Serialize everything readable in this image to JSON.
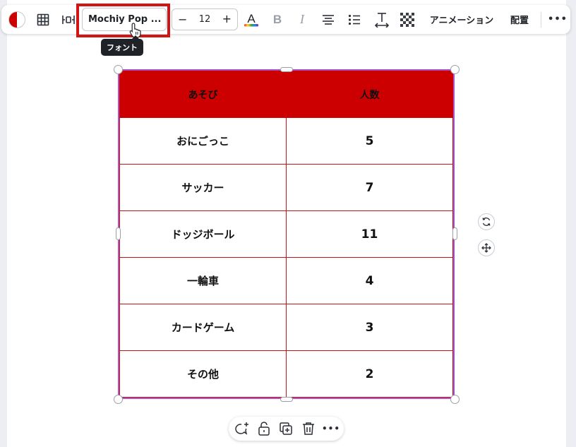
{
  "toolbar": {
    "font_name": "Mochiy Pop ...",
    "font_size": "12",
    "size_minus": "−",
    "size_plus": "+",
    "animation_label": "アニメーション",
    "arrange_label": "配置",
    "more_label": "•••",
    "text_color": "#cc0000"
  },
  "tooltip": {
    "text": "フォント"
  },
  "table": {
    "headers": [
      "あそび",
      "人数"
    ],
    "rows": [
      [
        "おにごっこ",
        "5"
      ],
      [
        "サッカー",
        "7"
      ],
      [
        "ドッジボール",
        "11"
      ],
      [
        "一輪車",
        "4"
      ],
      [
        "カードゲーム",
        "3"
      ],
      [
        "その他",
        "2"
      ]
    ],
    "header_color": "#cc0000",
    "border_color": "#c41414",
    "selection_color": "#a855c9"
  },
  "bottom_bar": {
    "more_label": "•••"
  },
  "icons": [
    "color-swatch-icon",
    "table-grid-icon",
    "spacing-icon",
    "text-color-icon",
    "bold-icon",
    "italic-icon",
    "align-center-icon",
    "list-icon",
    "text-spacing-icon",
    "transparency-icon",
    "rotate-icon",
    "move-icon",
    "comment-add-icon",
    "lock-icon",
    "duplicate-icon",
    "trash-icon"
  ]
}
